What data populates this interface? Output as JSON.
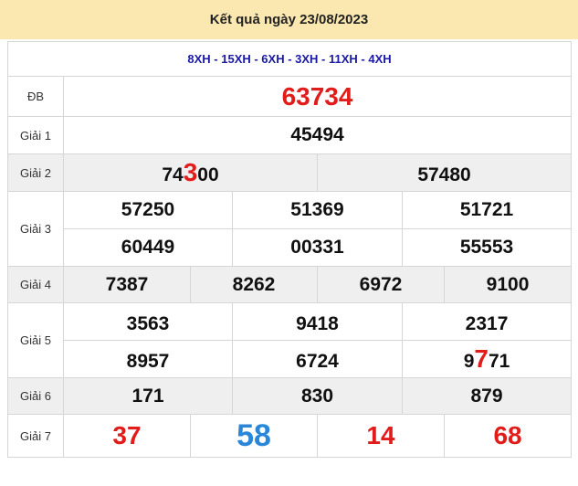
{
  "header": {
    "title": "Kết quả ngày 23/08/2023"
  },
  "codes": "8XH - 15XH - 6XH - 3XH - 11XH - 4XH",
  "labels": {
    "db": "ĐB",
    "g1": "Giải 1",
    "g2": "Giải 2",
    "g3": "Giải 3",
    "g4": "Giải 4",
    "g5": "Giải 5",
    "g6": "Giải 6",
    "g7": "Giải 7"
  },
  "prizes": {
    "db": "63734",
    "g1": "45494",
    "g2": [
      {
        "pre": "74",
        "hl": "3",
        "post": "00"
      },
      {
        "pre": "57480",
        "hl": "",
        "post": ""
      }
    ],
    "g3": [
      "57250",
      "51369",
      "51721",
      "60449",
      "00331",
      "55553"
    ],
    "g4": [
      "7387",
      "8262",
      "6972",
      "9100"
    ],
    "g5": [
      {
        "pre": "3563",
        "hl": "",
        "post": ""
      },
      {
        "pre": "9418",
        "hl": "",
        "post": ""
      },
      {
        "pre": "2317",
        "hl": "",
        "post": ""
      },
      {
        "pre": "8957",
        "hl": "",
        "post": ""
      },
      {
        "pre": "6724",
        "hl": "",
        "post": ""
      },
      {
        "pre": "9",
        "hl": "7",
        "post": "71"
      }
    ],
    "g6": [
      "171",
      "830",
      "879"
    ],
    "g7": [
      "37",
      "58",
      "14",
      "68"
    ]
  },
  "colors": {
    "header_bg": "#fbe8b0",
    "red": "#e21b1b",
    "blue": "#2a86d8",
    "codes": "#1a1aa6"
  }
}
